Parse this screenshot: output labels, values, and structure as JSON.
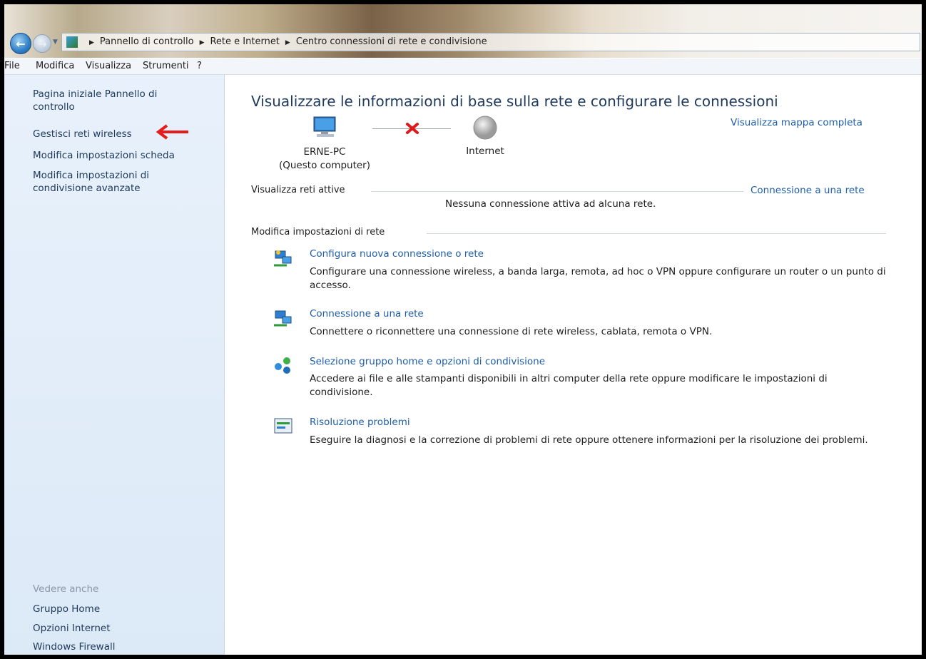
{
  "breadcrumb": {
    "items": [
      "Pannello di controllo",
      "Rete e Internet",
      "Centro connessioni di rete e condivisione"
    ]
  },
  "menubar": {
    "items": [
      "File",
      "Modifica",
      "Visualizza",
      "Strumenti",
      "?"
    ]
  },
  "sidebar": {
    "links": [
      "Pagina iniziale Pannello di controllo",
      "Gestisci reti wireless",
      "Modifica impostazioni scheda",
      "Modifica impostazioni di condivisione avanzate"
    ],
    "see_also_label": "Vedere anche",
    "see_also": [
      "Gruppo Home",
      "Opzioni Internet",
      "Windows Firewall"
    ],
    "annotation_color": "#e41c1c"
  },
  "main": {
    "title": "Visualizzare le informazioni di base sulla rete e configurare le connessioni",
    "full_map_link": "Visualizza mappa completa",
    "map": {
      "computer_name": "ERNE-PC",
      "computer_sub": "(Questo computer)",
      "internet_label": "Internet",
      "status": "disconnected"
    },
    "active_networks": {
      "label": "Visualizza reti attive",
      "connect_link": "Connessione a una rete",
      "none_text": "Nessuna connessione attiva ad alcuna rete."
    },
    "settings": {
      "label": "Modifica impostazioni di rete",
      "tasks": [
        {
          "icon": "new-connection-icon",
          "title": "Configura nuova connessione o rete",
          "desc": "Configurare una connessione wireless, a banda larga, remota, ad hoc o VPN oppure configurare un router o un punto di accesso."
        },
        {
          "icon": "connect-network-icon",
          "title": "Connessione a una rete",
          "desc": "Connettere o riconnettere una connessione di rete wireless, cablata, remota o VPN."
        },
        {
          "icon": "homegroup-icon",
          "title": "Selezione gruppo home e opzioni di condivisione",
          "desc": "Accedere ai file e alle stampanti disponibili in altri computer della rete oppure modificare le impostazioni di condivisione."
        },
        {
          "icon": "troubleshoot-icon",
          "title": "Risoluzione problemi",
          "desc": "Eseguire la diagnosi e la correzione di problemi di rete oppure ottenere informazioni per la risoluzione dei problemi."
        }
      ]
    }
  },
  "colors": {
    "link": "#1f5ea8",
    "sidebar_bg": "#dce9f7",
    "error_x": "#e01818"
  }
}
